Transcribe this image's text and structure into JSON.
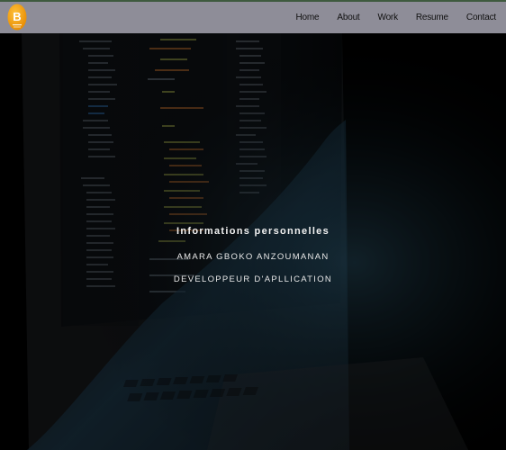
{
  "brand": {
    "logo_letter": "B",
    "logo_color": "#f2a20c"
  },
  "nav": {
    "items": [
      {
        "label": "Home"
      },
      {
        "label": "About"
      },
      {
        "label": "Work"
      },
      {
        "label": "Resume"
      },
      {
        "label": "Contact"
      }
    ],
    "bar_color": "#8e8d98"
  },
  "hero": {
    "heading": "Informations personnelles",
    "name": "AMARA GBOKO ANZOUMANAN",
    "role": "DEVELOPPEUR D'APLLICATION"
  }
}
